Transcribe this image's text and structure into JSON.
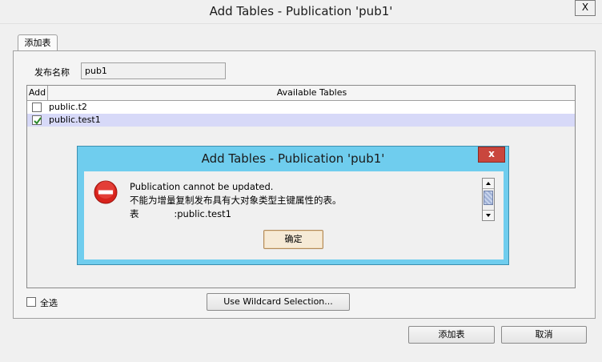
{
  "window": {
    "title": "Add Tables - Publication 'pub1'",
    "close_glyph": "X"
  },
  "tab": {
    "label": "添加表"
  },
  "form": {
    "pub_name_label": "发布名称",
    "pub_name_value": "pub1"
  },
  "table": {
    "columns": [
      "Add",
      "Available Tables"
    ],
    "rows": [
      {
        "checked": false,
        "name": "public.t2"
      },
      {
        "checked": true,
        "name": "public.test1"
      }
    ]
  },
  "dialog": {
    "title": "Add Tables - Publication 'pub1'",
    "close_glyph": "x",
    "icon": "error-icon",
    "lines": [
      "Publication cannot be updated.",
      "不能为增量复制发布具有大对象类型主键属性的表。",
      "表            :public.test1"
    ],
    "ok_label": "确定"
  },
  "bottom": {
    "select_all_label": "全选",
    "select_all_checked": false,
    "wildcard_label": "Use Wildcard Selection...",
    "add_label": "添加表",
    "cancel_label": "取消"
  },
  "colors": {
    "dialog_frame": "#6fcdee",
    "dialog_close": "#c9463d",
    "selected_row": "#d7d9f8",
    "checkmark": "#2b8a2b"
  }
}
